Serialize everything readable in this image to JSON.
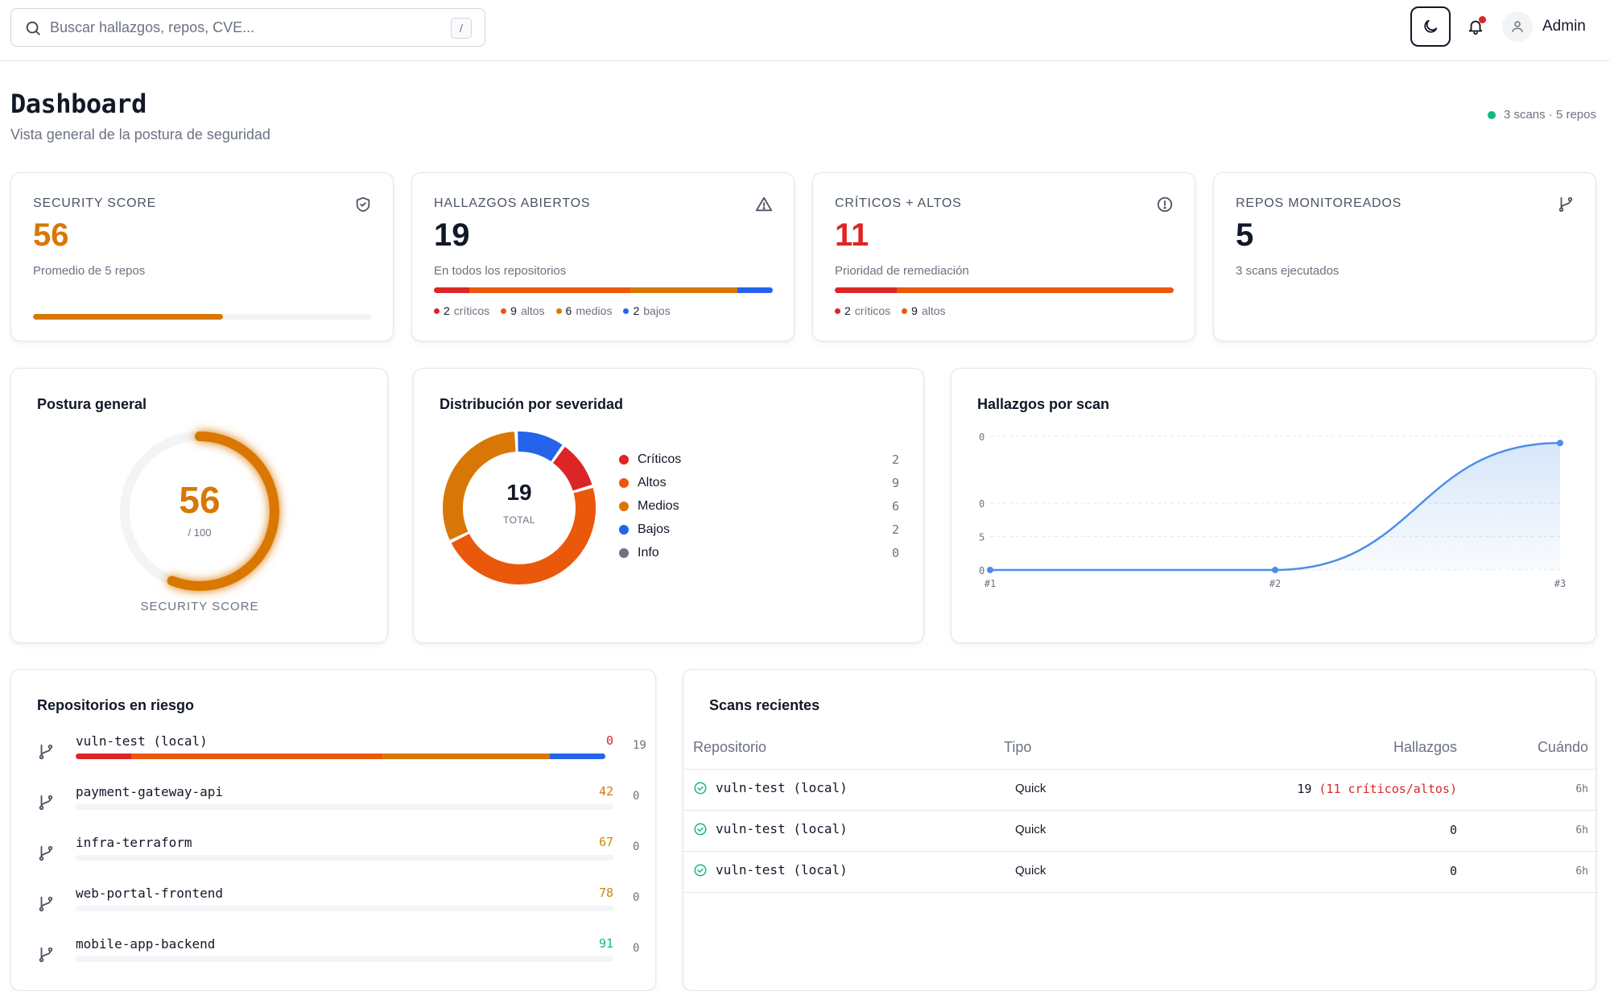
{
  "search": {
    "placeholder": "Buscar hallazgos, repos, CVE...",
    "shortcut": "/"
  },
  "user": {
    "name": "Admin"
  },
  "header": {
    "title": "Dashboard",
    "subtitle": "Vista general de la postura de seguridad",
    "status": "3 scans · 5 repos",
    "status_color": "#10b981"
  },
  "kpis": [
    {
      "label": "Security Score",
      "value": "56",
      "sub": "Promedio de 5 repos",
      "icon": "shield-check-icon",
      "value_color": "#d97706",
      "progress": 0.56
    },
    {
      "label": "Hallazgos abiertos",
      "value": "19",
      "sub": "En todos los repositorios",
      "icon": "warning-triangle-icon",
      "value_color": "#111827",
      "legend": [
        {
          "count": "2",
          "label": "críticos"
        },
        {
          "count": "9",
          "label": "altos"
        },
        {
          "count": "6",
          "label": "medios"
        },
        {
          "count": "2",
          "label": "bajos"
        }
      ]
    },
    {
      "label": "Críticos + Altos",
      "value": "11",
      "sub": "Prioridad de remediación",
      "icon": "alert-circle-icon",
      "value_color": "#dc2626",
      "legend": [
        {
          "count": "2",
          "label": "críticos"
        },
        {
          "count": "9",
          "label": "altos"
        }
      ]
    },
    {
      "label": "Repos monitoreados",
      "value": "5",
      "sub": "3 scans ejecutados",
      "icon": "git-branch-icon",
      "value_color": "#111827"
    }
  ],
  "colors": {
    "critical": "#dc2626",
    "high": "#ea580c",
    "medium": "#d97706",
    "low": "#2563eb",
    "info": "#6b7280",
    "good": "#10b981",
    "warn": "#ca8a04"
  },
  "posture": {
    "title": "Postura general",
    "score": "56",
    "max": "/ 100",
    "caption": "SECURITY SCORE",
    "fraction": 0.56
  },
  "severity": {
    "title": "Distribución por severidad",
    "total": "19",
    "total_label": "TOTAL",
    "items": [
      {
        "name": "Críticos",
        "count": "2",
        "color": "#dc2626"
      },
      {
        "name": "Altos",
        "count": "9",
        "color": "#ea580c"
      },
      {
        "name": "Medios",
        "count": "6",
        "color": "#d97706"
      },
      {
        "name": "Bajos",
        "count": "2",
        "color": "#2563eb"
      },
      {
        "name": "Info",
        "count": "0",
        "color": "#6b7280"
      }
    ]
  },
  "chart_data": {
    "type": "area",
    "title": "Hallazgos por scan",
    "categories": [
      "#1",
      "#2",
      "#3"
    ],
    "series": [
      {
        "values": [
          0,
          0,
          19
        ]
      }
    ],
    "ylim": [
      0,
      20
    ],
    "grid": true,
    "color": "#4a8fe7"
  },
  "repos": {
    "title": "Repositorios en riesgo",
    "items": [
      {
        "name": "vuln-test (local)",
        "score": "0",
        "count": "19",
        "score_color": "#dc2626",
        "segments": [
          0.105,
          0.474,
          0.316,
          0.105
        ]
      },
      {
        "name": "payment-gateway-api",
        "score": "42",
        "count": "0",
        "score_color": "#d97706",
        "segments": []
      },
      {
        "name": "infra-terraform",
        "score": "67",
        "count": "0",
        "score_color": "#ca8a04",
        "segments": []
      },
      {
        "name": "web-portal-frontend",
        "score": "78",
        "count": "0",
        "score_color": "#ca8a04",
        "segments": []
      },
      {
        "name": "mobile-app-backend",
        "score": "91",
        "count": "0",
        "score_color": "#10b981",
        "segments": []
      }
    ]
  },
  "scans": {
    "title": "Scans recientes",
    "columns": [
      "Repositorio",
      "Tipo",
      "Hallazgos",
      "Cuándo"
    ],
    "rows": [
      {
        "repo": "vuln-test (local)",
        "type": "Quick",
        "findings": "19",
        "note": "(11 críticos/altos)",
        "when": "6h"
      },
      {
        "repo": "vuln-test (local)",
        "type": "Quick",
        "findings": "0",
        "note": "",
        "when": "6h"
      },
      {
        "repo": "vuln-test (local)",
        "type": "Quick",
        "findings": "0",
        "note": "",
        "when": "6h"
      }
    ]
  }
}
